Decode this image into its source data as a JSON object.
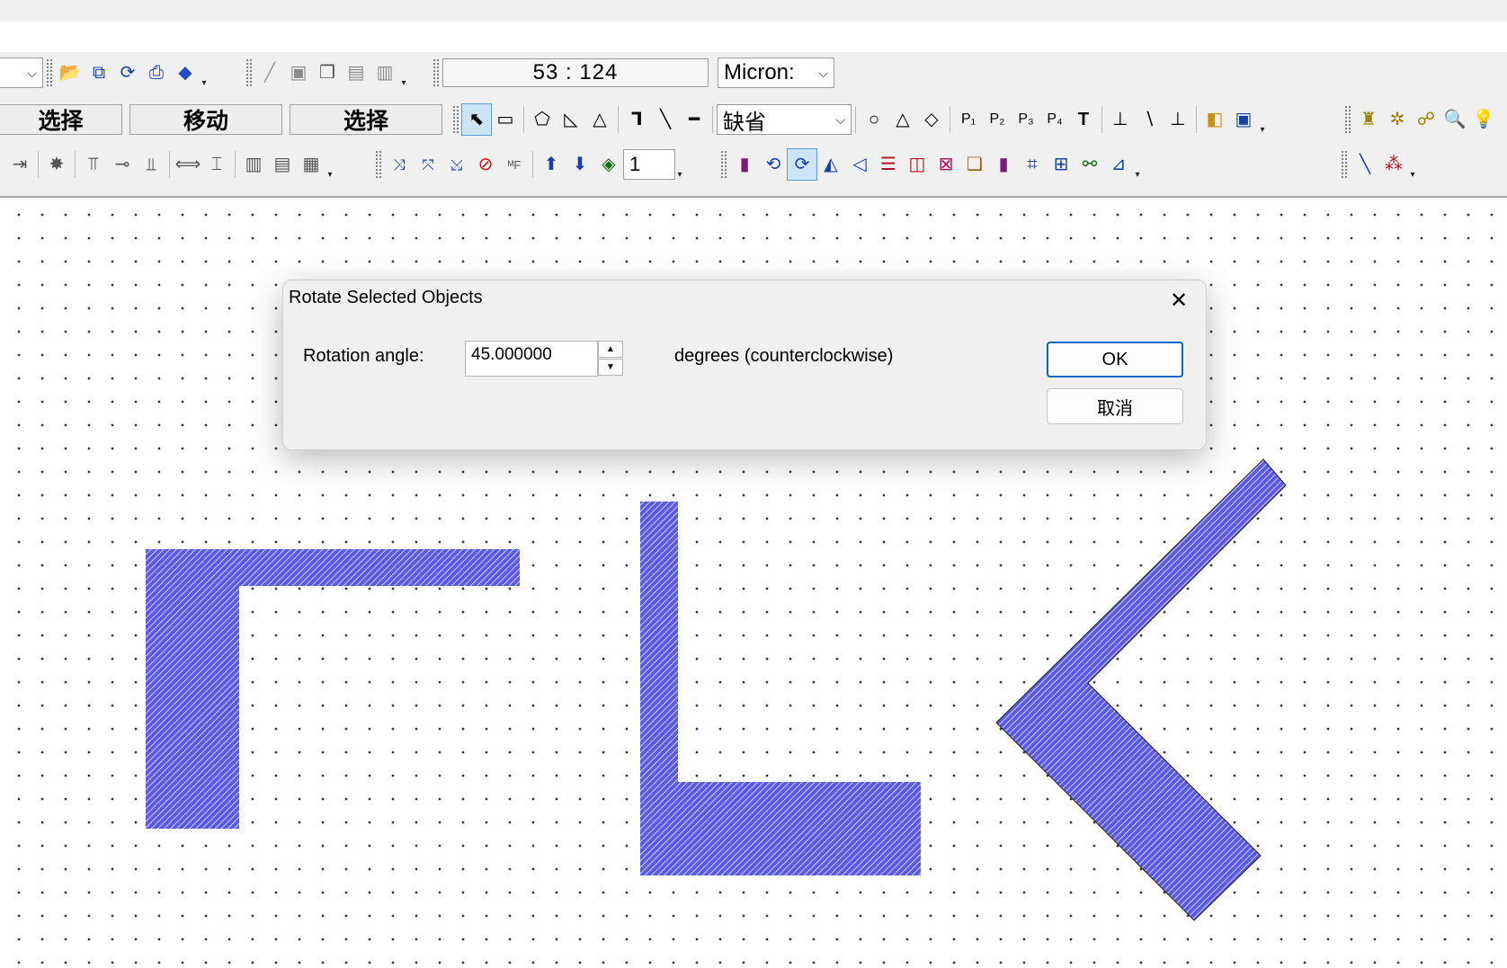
{
  "toolbar": {
    "coordinate_readout": "53 : 124",
    "units_combo": "Micron:",
    "mode_buttons": [
      "选择",
      "移动",
      "选择"
    ],
    "line_style_combo": "缺省",
    "layer_field": "1",
    "text_tool": "T"
  },
  "dialog": {
    "title": "Rotate Selected Objects",
    "close_glyph": "✕",
    "angle_label": "Rotation angle:",
    "angle_value": "45.000000",
    "unit_label": "degrees (counterclockwise)",
    "ok_label": "OK",
    "cancel_label": "取消"
  },
  "colors": {
    "shape_fill": "#5a5ae6",
    "hatch_line": "#ffffff",
    "grid_dot": "#3a3a3a",
    "dialog_bg": "#f0f0f0",
    "ok_border": "#0067c0"
  },
  "icons": [
    "open-folder-icon",
    "copy-icon",
    "refresh-icon",
    "print-icon",
    "eraser-icon",
    "pencil-icon",
    "save-icon",
    "save-all-icon",
    "arrow-select-icon",
    "rectangle-icon",
    "polygon-icon",
    "path-icon",
    "circle-icon",
    "mirror-icon",
    "zoom-icon"
  ]
}
